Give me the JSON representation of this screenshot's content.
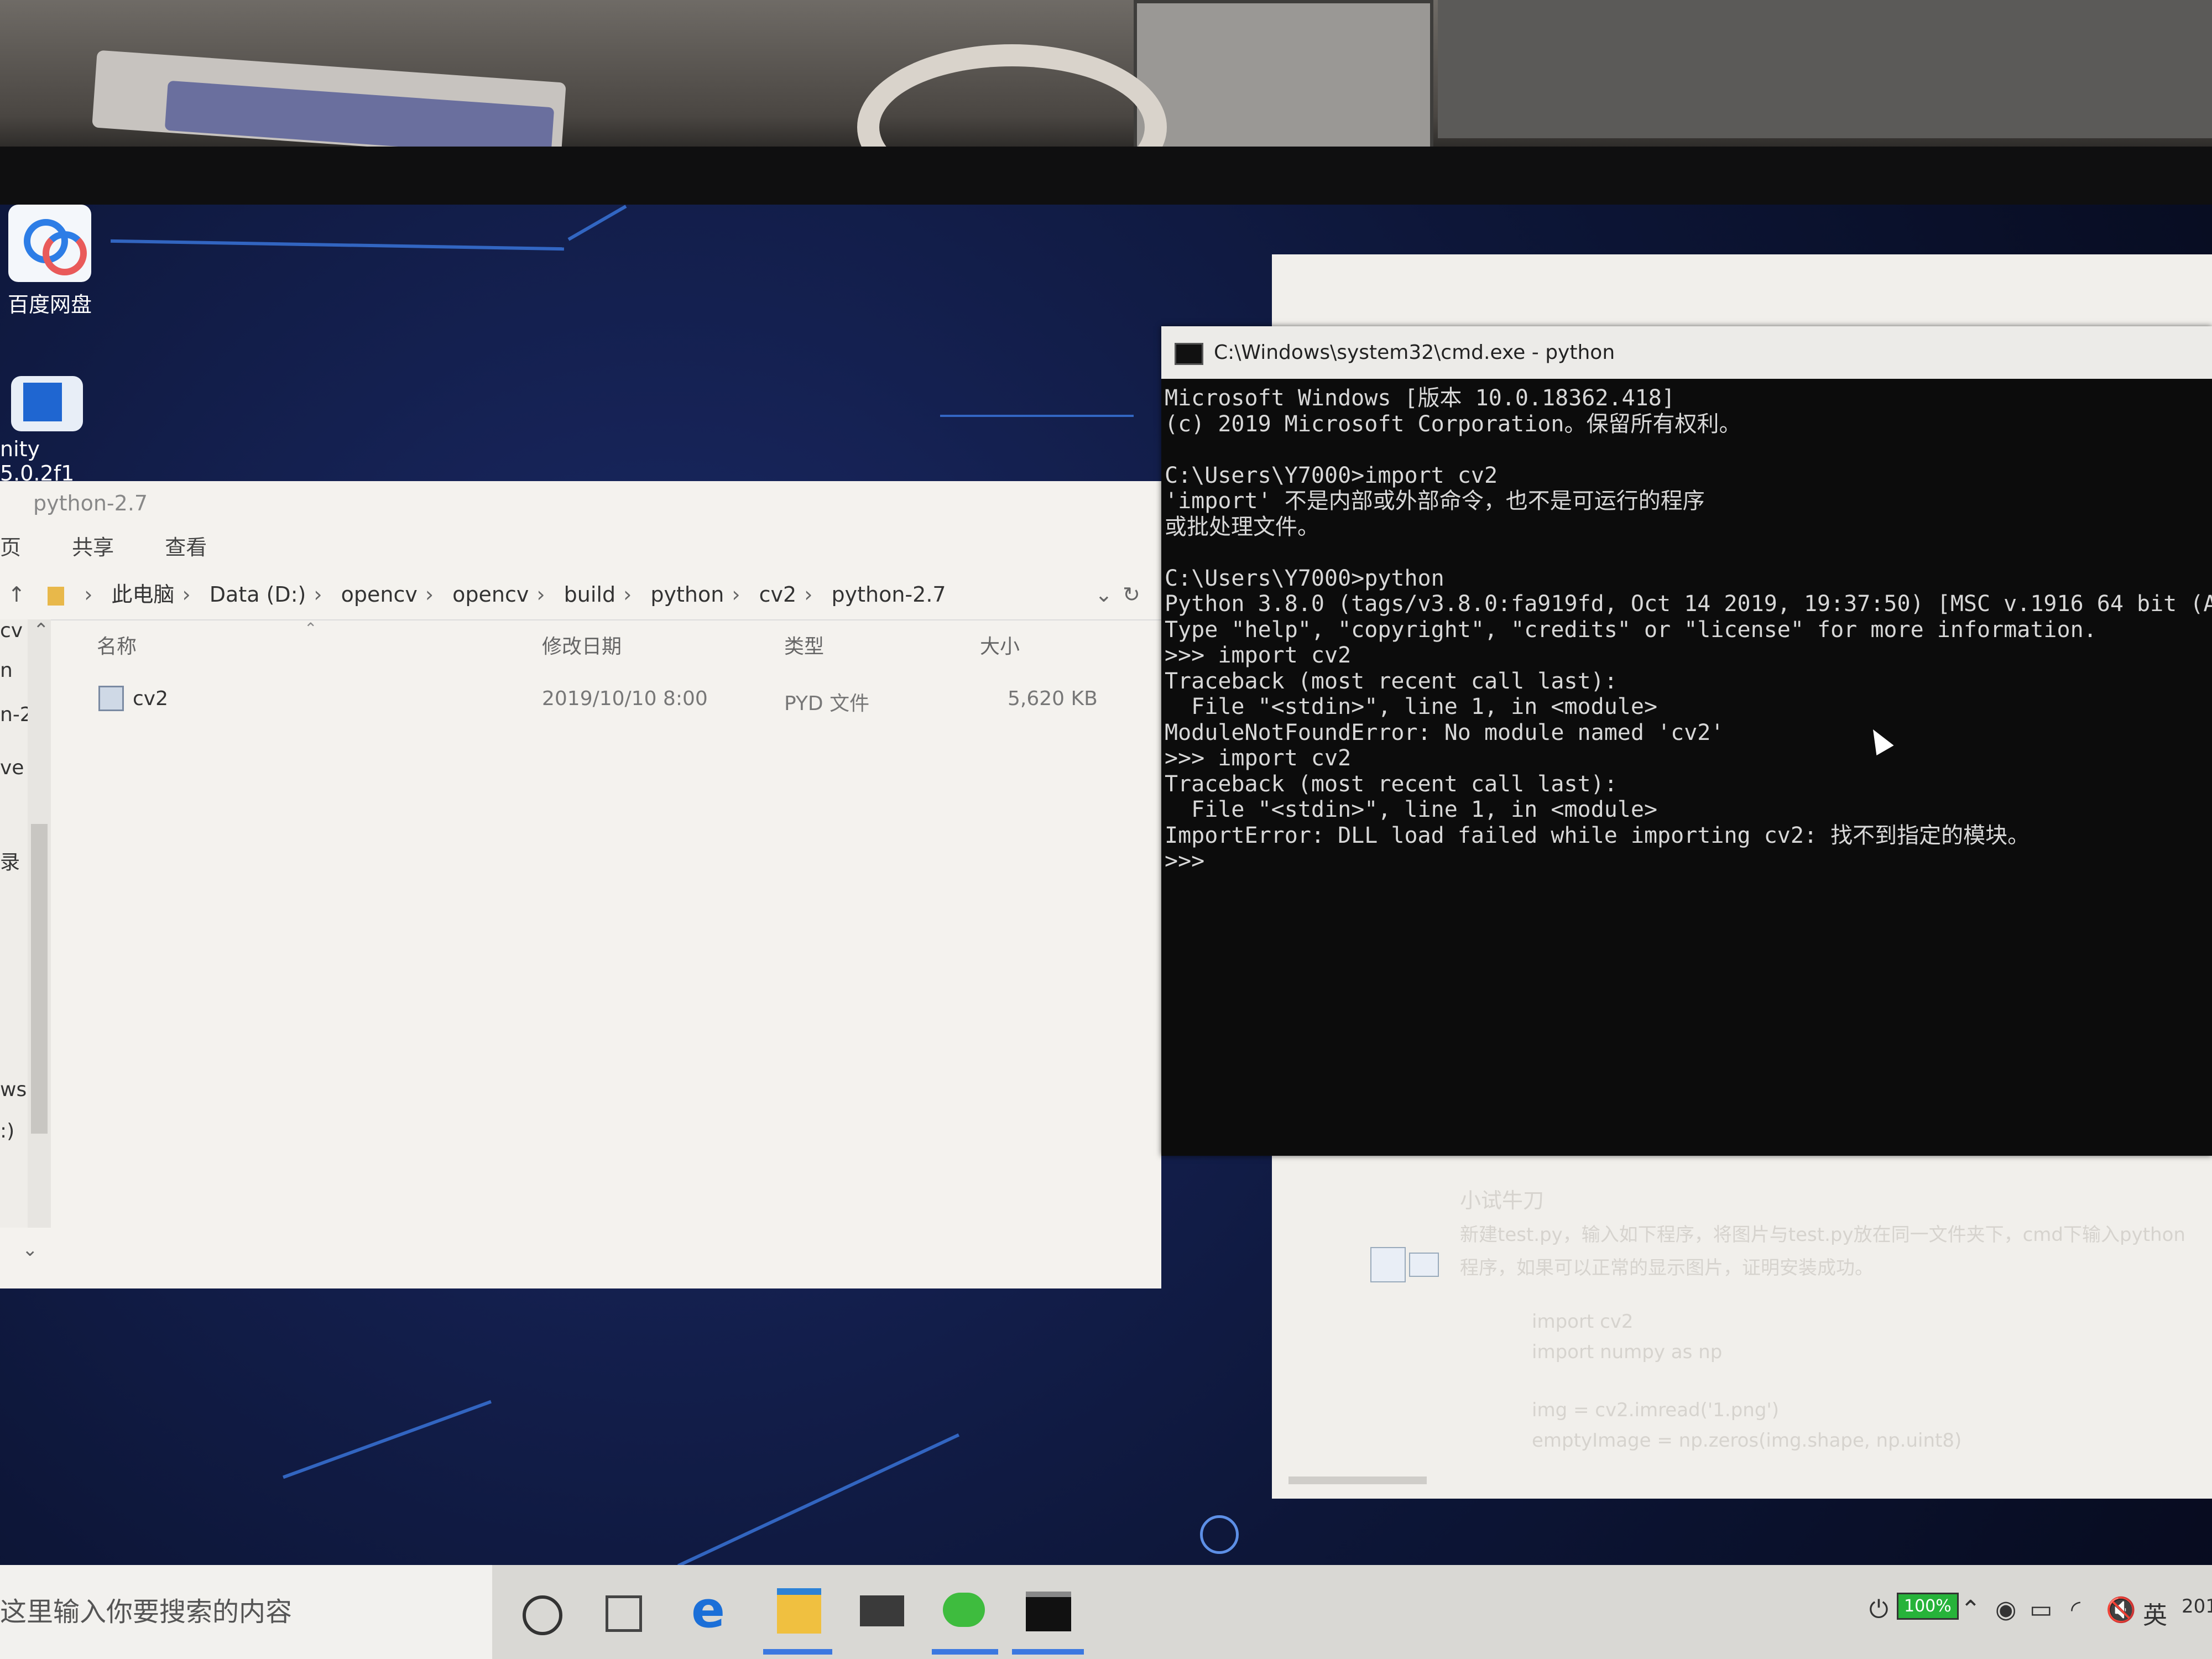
{
  "desktop": {
    "icons": [
      {
        "label": "百度网盘",
        "icon": "baidu-netdisk-icon"
      },
      {
        "label": "nity 5.0.2f1",
        "icon": "unity-shortcut-icon"
      }
    ]
  },
  "explorer": {
    "title": "python-2.7",
    "ribbon_tabs": [
      "页",
      "共享",
      "查看"
    ],
    "breadcrumb": [
      "此电脑",
      "Data (D:)",
      "opencv",
      "opencv",
      "build",
      "python",
      "cv2",
      "python-2.7"
    ],
    "nav_items": [
      "cv",
      "n",
      "n-2",
      "ve",
      "录",
      "ws",
      ":)"
    ],
    "columns": [
      "名称",
      "修改日期",
      "类型",
      "大小"
    ],
    "rows": [
      {
        "name": "cv2",
        "modified": "2019/10/10 8:00",
        "type": "PYD 文件",
        "size": "5,620 KB"
      }
    ]
  },
  "cmd": {
    "title": "C:\\Windows\\system32\\cmd.exe - python",
    "lines": [
      "Microsoft Windows [版本 10.0.18362.418]",
      "(c) 2019 Microsoft Corporation。保留所有权利。",
      "",
      "C:\\Users\\Y7000>import cv2",
      "'import' 不是内部或外部命令，也不是可运行的程序",
      "或批处理文件。",
      "",
      "C:\\Users\\Y7000>python",
      "Python 3.8.0 (tags/v3.8.0:fa919fd, Oct 14 2019, 19:37:50) [MSC v.1916 64 bit (AMD64",
      "Type \"help\", \"copyright\", \"credits\" or \"license\" for more information.",
      ">>> import cv2",
      "Traceback (most recent call last):",
      "  File \"<stdin>\", line 1, in <module>",
      "ModuleNotFoundError: No module named 'cv2'",
      ">>> import cv2",
      "Traceback (most recent call last):",
      "  File \"<stdin>\", line 1, in <module>",
      "ImportError: DLL load failed while importing cv2: 找不到指定的模块。",
      ">>>"
    ]
  },
  "background_doc": {
    "lines": [
      "小试牛刀",
      "新建test.py，输入如下程序，将图片与test.py放在同一文件夹下，cmd下输入python",
      "程序，如果可以正常的显示图片，证明安装成功。",
      "import cv2",
      "import numpy as np",
      "img = cv2.imread('1.png')",
      "emptyImage = np.zeros(img.shape, np.uint8)"
    ]
  },
  "taskbar": {
    "search_placeholder": "这里输入你要搜索的内容",
    "apps": [
      "cortana-icon",
      "task-view-icon",
      "edge-icon",
      "file-explorer-icon",
      "mail-icon",
      "wechat-icon",
      "cmd-icon"
    ],
    "battery": "100%",
    "ime": "英",
    "clock_partial": "201"
  },
  "colors": {
    "cmd_bg": "#0c0c0c",
    "cmd_text": "#d8d8d8",
    "desktop_blue": "#1b2a67",
    "accent": "#3b78e0"
  }
}
